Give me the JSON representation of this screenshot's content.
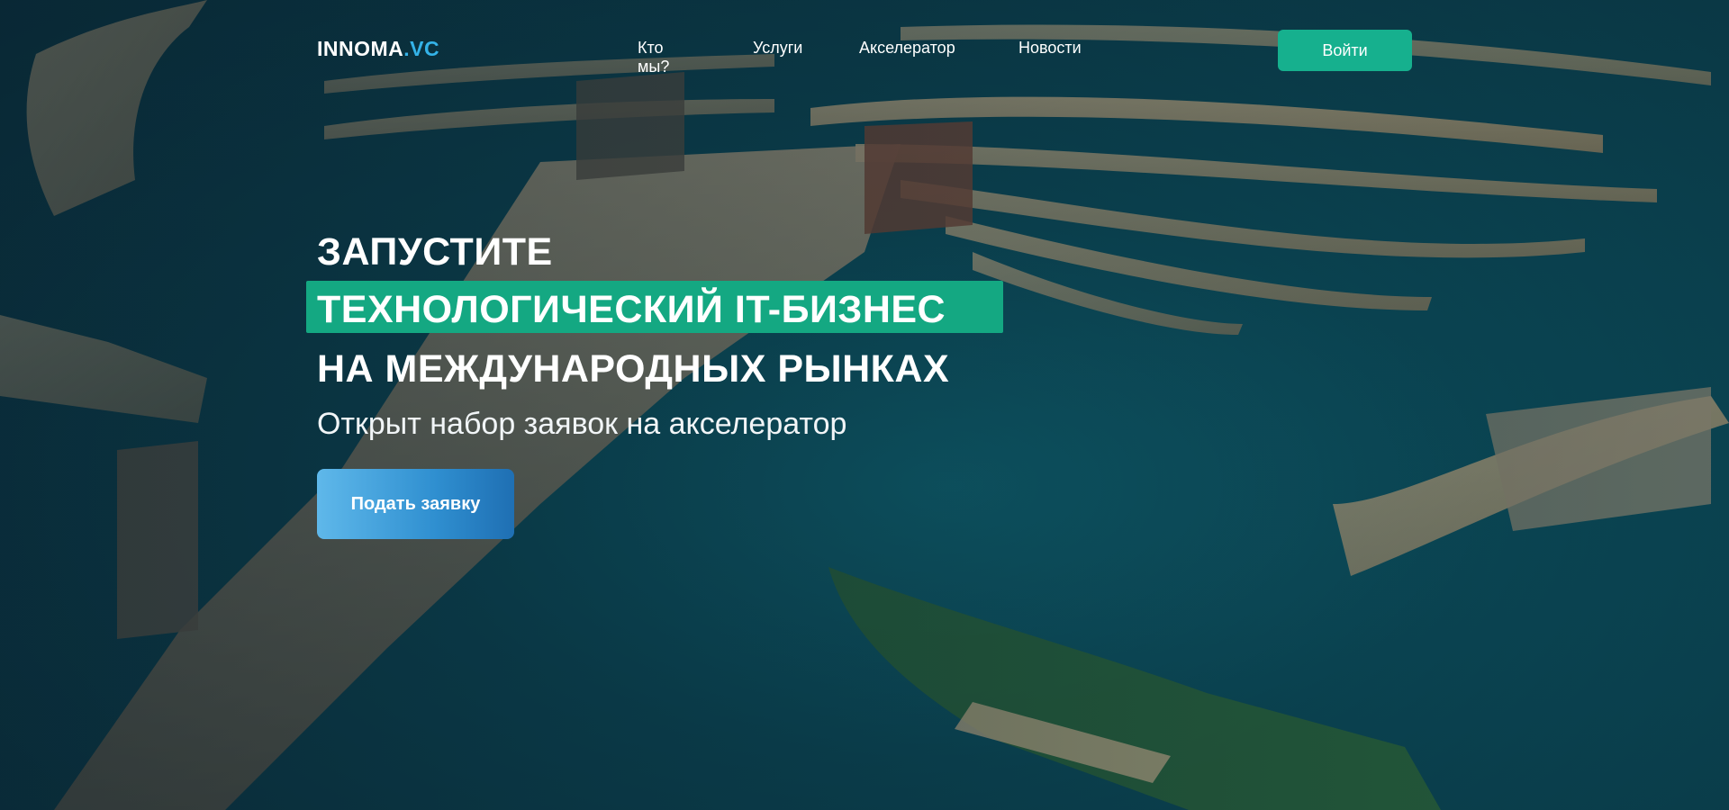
{
  "header": {
    "logo_main": "INNOMA",
    "logo_accent": ".VC",
    "nav": [
      "Кто мы?",
      "Услуги",
      "Акселератор",
      "Новости"
    ],
    "login_label": "Войти"
  },
  "hero": {
    "line1": "ЗАПУСТИТЕ",
    "line2": "ТЕХНОЛОГИЧЕСКИЙ IT-БИЗНЕС",
    "line3": "НА МЕЖДУНАРОДНЫХ РЫНКАХ",
    "subtitle": "Открыт набор заявок на акселератор",
    "cta_label": "Подать заявку"
  },
  "colors": {
    "accent_green": "#16b08e",
    "highlight_green": "#14a882",
    "cta_blue_start": "#5fb8ea",
    "cta_blue_end": "#1f6fb3",
    "logo_accent": "#34b3e8"
  }
}
